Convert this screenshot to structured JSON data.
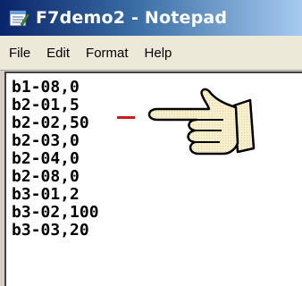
{
  "window": {
    "title": "F7demo2 - Notepad"
  },
  "menu": {
    "items": [
      "File",
      "Edit",
      "Format",
      "Help"
    ]
  },
  "editor": {
    "lines": [
      "b1-08,0",
      "b2-01,5",
      "b2-02,50",
      "b2-03,0",
      "b2-04,0",
      "b2-08,0",
      "b3-01,2",
      "b3-02,100",
      "b3-03,20"
    ]
  },
  "colors": {
    "title_gradient_start": "#0a246a",
    "title_gradient_end": "#a6caf0",
    "cursor_mark": "#cc1b1b"
  },
  "icons": {
    "app": "notepad-icon",
    "pointer": "pointing-hand-icon"
  }
}
